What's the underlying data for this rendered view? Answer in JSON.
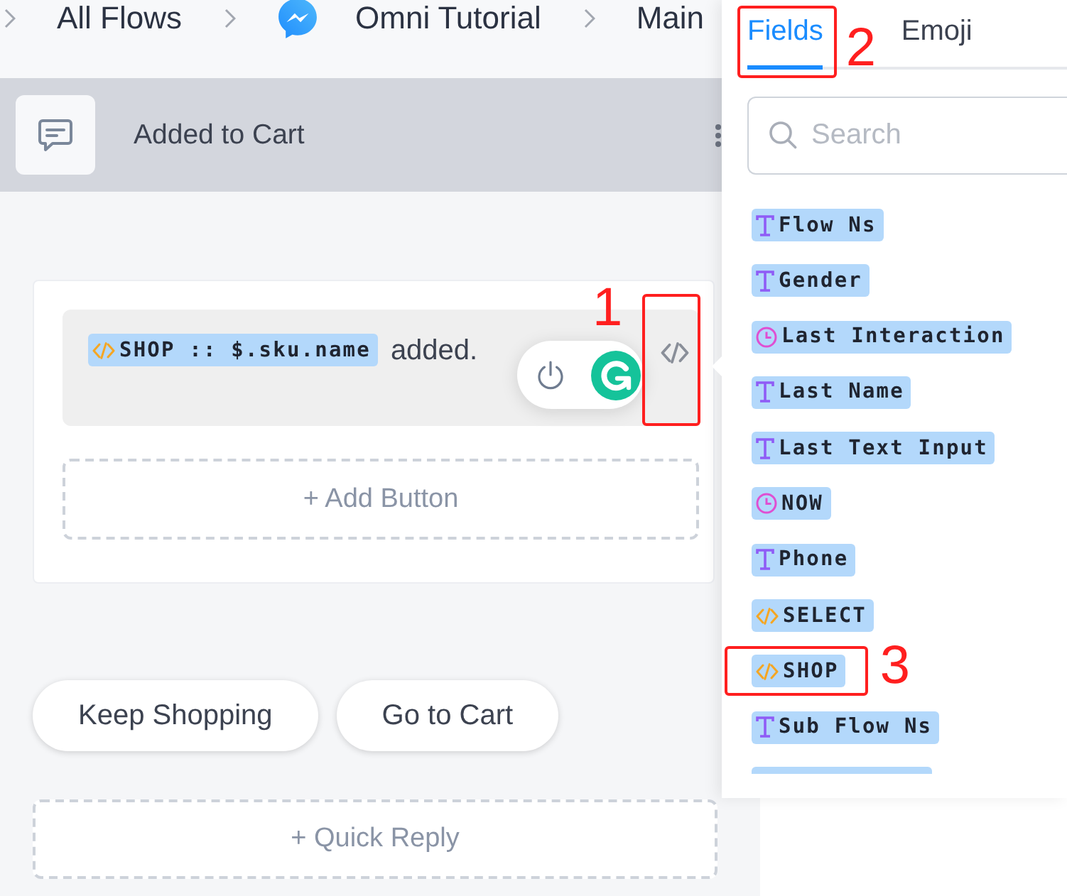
{
  "breadcrumb": [
    {
      "kind": "link",
      "label": "All Flows"
    },
    {
      "kind": "channel",
      "label": "Omni Tutorial"
    },
    {
      "kind": "link",
      "label": "Main"
    }
  ],
  "node": {
    "title": "Added to Cart"
  },
  "message": {
    "chip": {
      "kind": "code",
      "label": "SHOP :: $.sku.name"
    },
    "text": "added.",
    "code_button": {
      "annotation": "1"
    },
    "add_button": "+ Add Button"
  },
  "reply_buttons": [
    "Keep Shopping",
    "Go to Cart"
  ],
  "quick_reply": "+ Quick Reply",
  "panel": {
    "tabs": [
      {
        "label": "Fields",
        "selected": true,
        "annotation": "2"
      },
      {
        "label": "Emoji",
        "selected": false
      }
    ],
    "search": {
      "placeholder": "Search"
    },
    "fields": [
      {
        "kind": "text",
        "label": "Flow Ns"
      },
      {
        "kind": "text",
        "label": "Gender"
      },
      {
        "kind": "datetime",
        "label": "Last Interaction"
      },
      {
        "kind": "text",
        "label": "Last Name"
      },
      {
        "kind": "text",
        "label": "Last Text Input"
      },
      {
        "kind": "datetime",
        "label": "NOW"
      },
      {
        "kind": "text",
        "label": "Phone"
      },
      {
        "kind": "code",
        "label": "SELECT"
      },
      {
        "kind": "code",
        "label": "SHOP",
        "annotation": "3"
      },
      {
        "kind": "text",
        "label": "Sub Flow Ns"
      }
    ]
  }
}
